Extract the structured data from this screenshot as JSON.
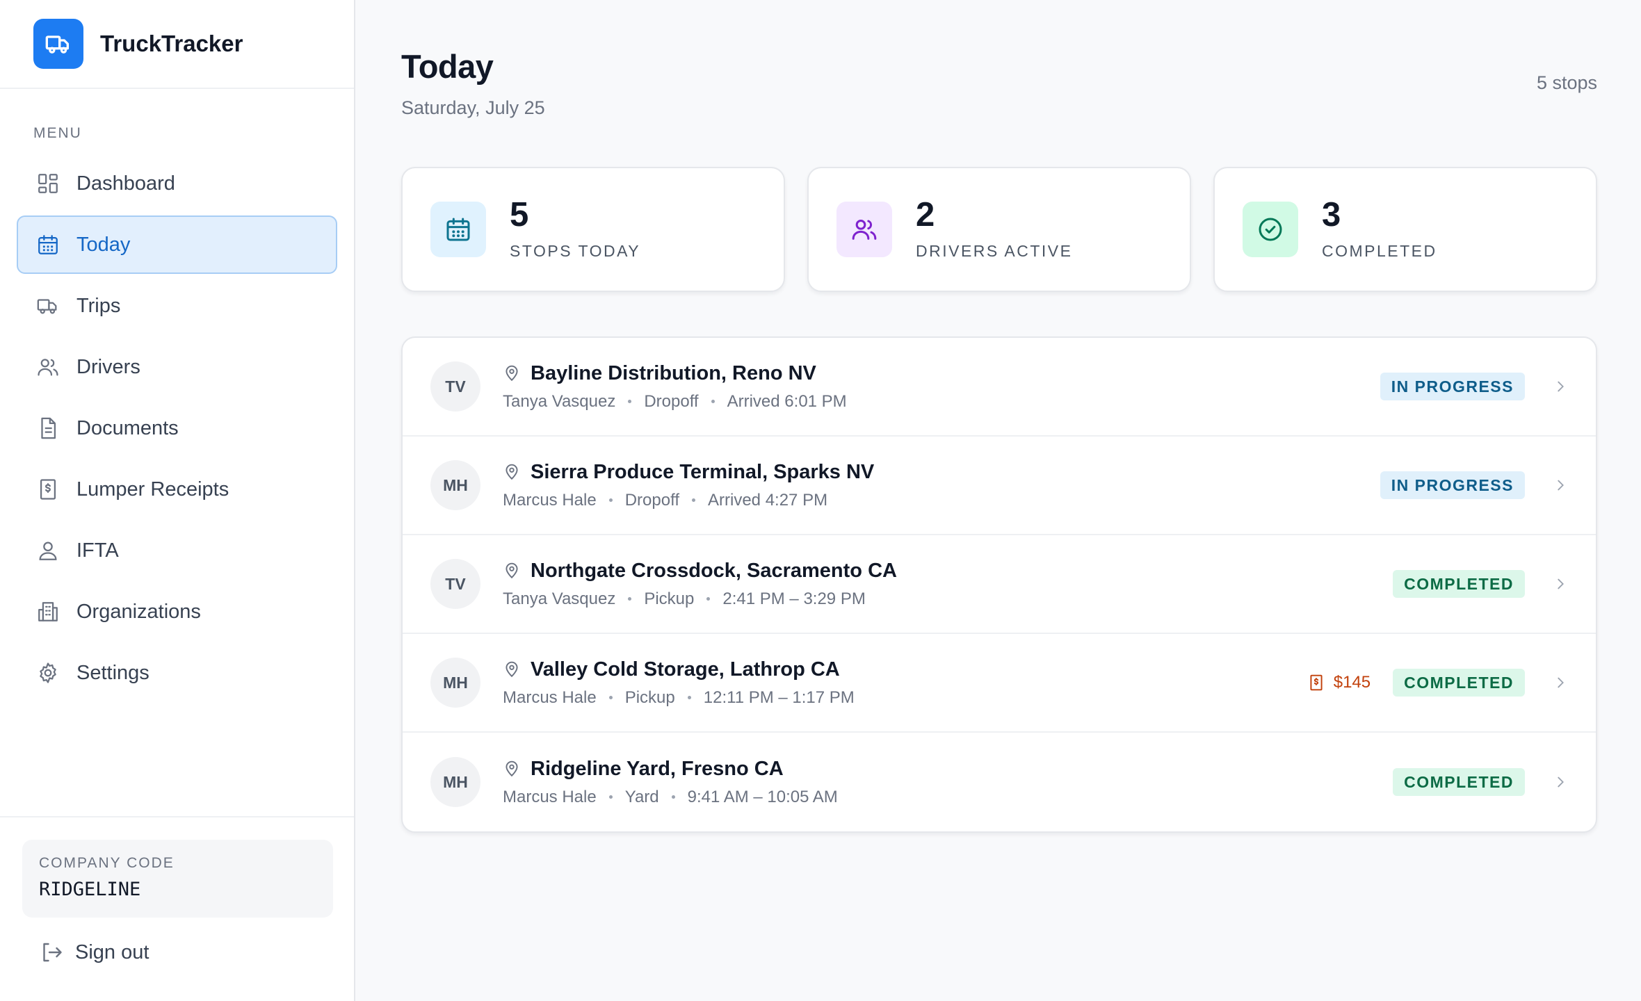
{
  "app": {
    "name": "TruckTracker"
  },
  "sidebar": {
    "menu_heading": "MENU",
    "items": [
      {
        "label": "Dashboard",
        "icon": "dashboard-icon",
        "active": false
      },
      {
        "label": "Today",
        "icon": "calendar-icon",
        "active": true
      },
      {
        "label": "Trips",
        "icon": "truck-icon",
        "active": false
      },
      {
        "label": "Drivers",
        "icon": "users-icon",
        "active": false
      },
      {
        "label": "Documents",
        "icon": "document-icon",
        "active": false
      },
      {
        "label": "Lumper Receipts",
        "icon": "receipt-icon",
        "active": false
      },
      {
        "label": "IFTA",
        "icon": "map-pin-user-icon",
        "active": false
      },
      {
        "label": "Organizations",
        "icon": "building-icon",
        "active": false
      },
      {
        "label": "Settings",
        "icon": "gear-icon",
        "active": false
      }
    ],
    "company_label": "COMPANY CODE",
    "company_code": "RIDGELINE",
    "sign_out": "Sign out"
  },
  "header": {
    "title": "Today",
    "date": "Saturday, July 25",
    "stop_count": "5 stops"
  },
  "stats": [
    {
      "value": "5",
      "label": "STOPS TODAY",
      "icon": "calendar-icon",
      "color": "#0e7490"
    },
    {
      "value": "2",
      "label": "DRIVERS ACTIVE",
      "icon": "users-icon",
      "color": "#7e22ce"
    },
    {
      "value": "3",
      "label": "COMPLETED",
      "icon": "check-circle-icon",
      "color": "#047857"
    }
  ],
  "stops": [
    {
      "initials": "TV",
      "location": "Bayline Distribution, Reno NV",
      "driver": "Tanya Vasquez",
      "type": "Dropoff",
      "time": "Arrived 6:01 PM",
      "receipt": "",
      "status": "IN PROGRESS",
      "status_kind": "inprogress"
    },
    {
      "initials": "MH",
      "location": "Sierra Produce Terminal, Sparks NV",
      "driver": "Marcus Hale",
      "type": "Dropoff",
      "time": "Arrived 4:27 PM",
      "receipt": "",
      "status": "IN PROGRESS",
      "status_kind": "inprogress"
    },
    {
      "initials": "TV",
      "location": "Northgate Crossdock, Sacramento CA",
      "driver": "Tanya Vasquez",
      "type": "Pickup",
      "time": "2:41 PM – 3:29 PM",
      "receipt": "",
      "status": "COMPLETED",
      "status_kind": "completed"
    },
    {
      "initials": "MH",
      "location": "Valley Cold Storage, Lathrop CA",
      "driver": "Marcus Hale",
      "type": "Pickup",
      "time": "12:11 PM – 1:17 PM",
      "receipt": "$145",
      "status": "COMPLETED",
      "status_kind": "completed"
    },
    {
      "initials": "MH",
      "location": "Ridgeline Yard, Fresno CA",
      "driver": "Marcus Hale",
      "type": "Yard",
      "time": "9:41 AM – 10:05 AM",
      "receipt": "",
      "status": "COMPLETED",
      "status_kind": "completed"
    }
  ],
  "colors": {
    "accent": "#1d7cf2",
    "active_bg": "#e2effd",
    "receipt": "#c2410c"
  }
}
